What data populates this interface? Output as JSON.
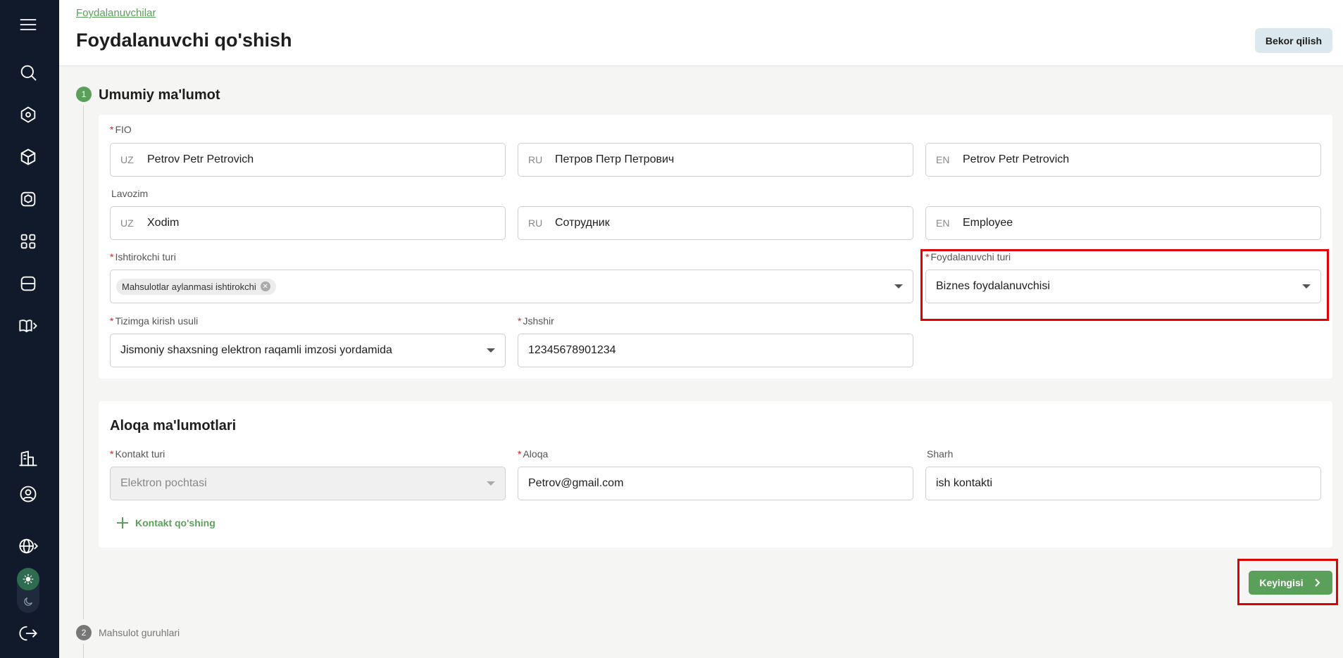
{
  "header": {
    "breadcrumb": "Foydalanuvchilar",
    "title": "Foydalanuvchi qo'shish",
    "cancel_label": "Bekor qilish"
  },
  "sidebar": {
    "icons": [
      "menu-icon",
      "search-icon",
      "home-icon",
      "cube-icon",
      "box-icon",
      "scan-icon",
      "storage-icon",
      "book-icon",
      "building-icon",
      "user-circle-icon",
      "globe-icon",
      "sun-icon",
      "moon-icon",
      "logout-icon"
    ]
  },
  "steps": [
    {
      "num": "1",
      "title": "Umumiy ma'lumot"
    },
    {
      "num": "2",
      "title": "Mahsulot guruhlari"
    }
  ],
  "general": {
    "fio_label": "FIO",
    "fio": [
      {
        "prefix": "UZ",
        "value": "Petrov Petr Petrovich"
      },
      {
        "prefix": "RU",
        "value": "Петров Петр Петрович"
      },
      {
        "prefix": "EN",
        "value": "Petrov Petr Petrovich"
      }
    ],
    "position_label": "Lavozim",
    "position": [
      {
        "prefix": "UZ",
        "value": "Xodim"
      },
      {
        "prefix": "RU",
        "value": "Сотрудник"
      },
      {
        "prefix": "EN",
        "value": "Employee"
      }
    ],
    "participant_type_label": "Ishtirokchi turi",
    "participant_type_chip": "Mahsulotlar aylanmasi ishtirokchi",
    "user_type_label": "Foydalanuvchi turi",
    "user_type_value": "Biznes foydalanuvchisi",
    "login_method_label": "Tizimga kirish usuli",
    "login_method_value": "Jismoniy shaxsning elektron raqamli imzosi yordamida",
    "jshshir_label": "Jshshir",
    "jshshir_value": "12345678901234"
  },
  "contacts": {
    "title": "Aloqa ma'lumotlari",
    "type_label": "Kontakt turi",
    "type_value": "Elektron pochtasi",
    "contact_label": "Aloqa",
    "contact_value": "Petrov@gmail.com",
    "comment_label": "Sharh",
    "comment_value": "ish kontakti",
    "add_label": "Kontakt qo'shing"
  },
  "next_label": "Keyingisi",
  "colors": {
    "accent": "#5aa05b",
    "sidebar": "#111a2b",
    "highlight": "#e00000"
  }
}
